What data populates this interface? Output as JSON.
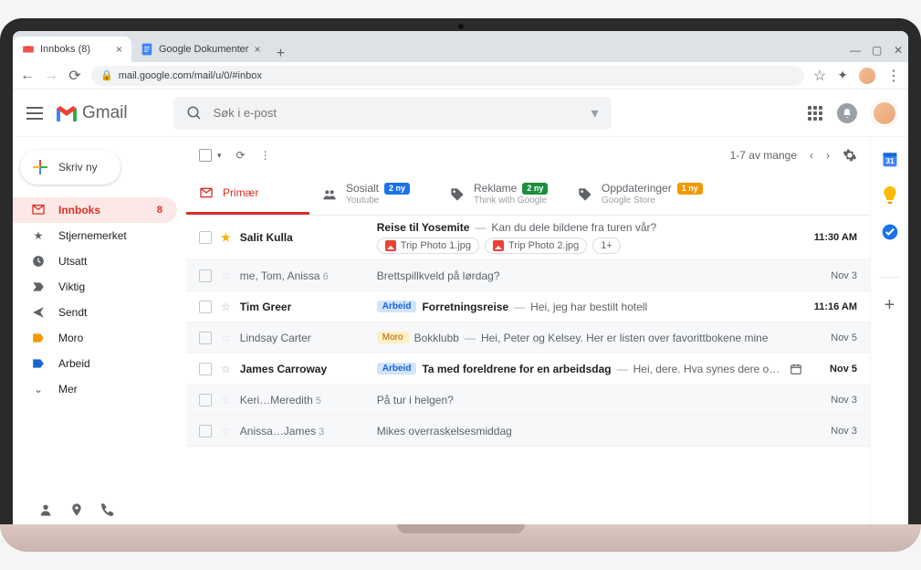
{
  "browser": {
    "tabs": [
      {
        "title": "Innboks (8)",
        "active": true
      },
      {
        "title": "Google Dokumenter",
        "active": false
      }
    ],
    "url": "mail.google.com/mail/u/0/#inbox"
  },
  "header": {
    "app_name": "Gmail",
    "search_placeholder": "Søk i e-post"
  },
  "compose_label": "Skriv ny",
  "folders": [
    {
      "id": "inbox",
      "label": "Innboks",
      "count": "8",
      "active": true
    },
    {
      "id": "starred",
      "label": "Stjernemerket"
    },
    {
      "id": "snoozed",
      "label": "Utsatt"
    },
    {
      "id": "important",
      "label": "Viktig"
    },
    {
      "id": "sent",
      "label": "Sendt"
    },
    {
      "id": "fun",
      "label": "Moro"
    },
    {
      "id": "work",
      "label": "Arbeid"
    },
    {
      "id": "more",
      "label": "Mer"
    }
  ],
  "toolbar": {
    "pagination": "1-7 av mange"
  },
  "categories": [
    {
      "id": "primary",
      "label": "Primær"
    },
    {
      "id": "social",
      "label": "Sosialt",
      "badge": "2 ny",
      "badge_color": "blue",
      "sub": "Youtube"
    },
    {
      "id": "promo",
      "label": "Reklame",
      "badge": "2 ny",
      "badge_color": "green",
      "sub": "Think with Google"
    },
    {
      "id": "updates",
      "label": "Oppdateringer",
      "badge": "1 ny",
      "badge_color": "orange",
      "sub": "Google Store"
    }
  ],
  "emails": [
    {
      "unread": true,
      "starred": true,
      "sender": "Salit Kulla",
      "subject": "Reise til Yosemite",
      "snippet": "Kan du dele bildene fra turen vår?",
      "date": "11:30 AM",
      "attachments": [
        {
          "name": "Trip Photo 1.jpg"
        },
        {
          "name": "Trip Photo 2.jpg"
        },
        {
          "more": "1+"
        }
      ]
    },
    {
      "unread": false,
      "sender": "me, Tom, Anissa",
      "sender_count": "6",
      "subject": "Brettspillkveld på lørdag?",
      "date": "Nov 3"
    },
    {
      "unread": true,
      "sender": "Tim Greer",
      "tag": "Arbeid",
      "tag_class": "arbeid",
      "subject": "Forretningsreise",
      "snippet": "Hei, jeg har bestilt hotell",
      "date": "11:16 AM"
    },
    {
      "unread": false,
      "sender": "Lindsay Carter",
      "tag": "Moro",
      "tag_class": "moro",
      "subject": "Bokklubb",
      "snippet": "Hei, Peter og Kelsey. Her er listen over favorittbokene mine",
      "date": "Nov 5"
    },
    {
      "unread": true,
      "sender": "James Carroway",
      "tag": "Arbeid",
      "tag_class": "arbeid",
      "subject": "Ta med foreldrene for en arbeidsdag",
      "snippet": "Hei, dere. Hva synes dere om …",
      "date": "Nov 5",
      "calendar": true
    },
    {
      "unread": false,
      "sender": "Keri…Meredith",
      "sender_count": "5",
      "subject": "På tur i helgen?",
      "date": "Nov 3"
    },
    {
      "unread": false,
      "sender": "Anissa…James",
      "sender_count": "3",
      "subject": "Mikes overraskelsesmiddag",
      "date": "Nov 3"
    }
  ]
}
